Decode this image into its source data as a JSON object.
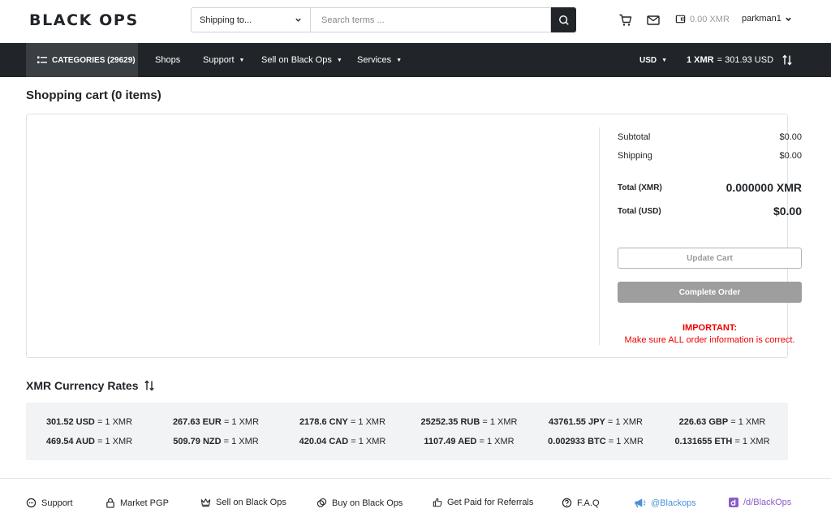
{
  "header": {
    "logo": "BLACK OPS",
    "shipping_select": "Shipping to...",
    "search_placeholder": "Search terms ...",
    "wallet_balance": "0.00 XMR",
    "username": "parkman1"
  },
  "nav": {
    "categories": "CATEGORIES (29629)",
    "items": [
      {
        "label": "Shops"
      },
      {
        "label": "Support"
      },
      {
        "label": "Sell on Black Ops"
      },
      {
        "label": "Services"
      }
    ],
    "currency": "USD",
    "rate_prefix": "1 XMR",
    "rate_value": "= 301.93 USD"
  },
  "cart": {
    "title": "Shopping cart (0 items)",
    "subtotal_label": "Subtotal",
    "subtotal_value": "$0.00",
    "shipping_label": "Shipping",
    "shipping_value": "$0.00",
    "total_xmr_label": "Total (XMR)",
    "total_xmr_value": "0.000000 XMR",
    "total_usd_label": "Total (USD)",
    "total_usd_value": "$0.00",
    "update_button": "Update Cart",
    "complete_button": "Complete Order",
    "important_head": "IMPORTANT:",
    "important_text": "Make sure ALL order information is correct."
  },
  "rates": {
    "title": "XMR Currency Rates",
    "row1": [
      {
        "amount": "301.52 USD",
        "suffix": "= 1 XMR"
      },
      {
        "amount": "267.63 EUR",
        "suffix": "= 1 XMR"
      },
      {
        "amount": "2178.6 CNY",
        "suffix": "= 1 XMR"
      },
      {
        "amount": "25252.35 RUB",
        "suffix": "= 1 XMR"
      },
      {
        "amount": "43761.55 JPY",
        "suffix": "= 1 XMR"
      },
      {
        "amount": "226.63 GBP",
        "suffix": "= 1 XMR"
      }
    ],
    "row2": [
      {
        "amount": "469.54 AUD",
        "suffix": "= 1 XMR"
      },
      {
        "amount": "509.79 NZD",
        "suffix": "= 1 XMR"
      },
      {
        "amount": "420.04 CAD",
        "suffix": "= 1 XMR"
      },
      {
        "amount": "1107.49 AED",
        "suffix": "= 1 XMR"
      },
      {
        "amount": "0.002933 BTC",
        "suffix": "= 1 XMR"
      },
      {
        "amount": "0.131655 ETH",
        "suffix": "= 1 XMR"
      }
    ]
  },
  "footer": {
    "links": [
      {
        "label": "Support"
      },
      {
        "label": "Market PGP"
      },
      {
        "label": "Sell on Black Ops"
      },
      {
        "label": "Buy on Black Ops"
      },
      {
        "label": "Get Paid for Referrals"
      },
      {
        "label": "F.A.Q"
      },
      {
        "label": "@Blackops"
      },
      {
        "label": "/d/BlackOps"
      }
    ]
  },
  "colors": {
    "navbar": "#212529",
    "accent_red": "#ee0000",
    "link_purple": "#8a5cc8",
    "link_blue": "#4a90d9"
  }
}
